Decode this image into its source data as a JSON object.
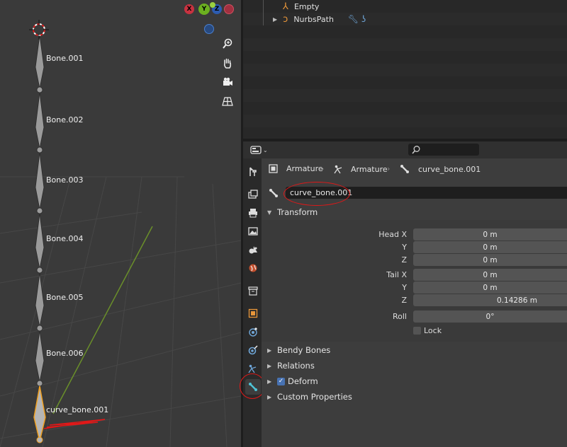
{
  "viewport": {
    "bones": [
      {
        "label": "Bone.001"
      },
      {
        "label": "Bone.002"
      },
      {
        "label": "Bone.003"
      },
      {
        "label": "Bone.004"
      },
      {
        "label": "Bone.005"
      },
      {
        "label": "Bone.006"
      },
      {
        "label": "curve_bone.001"
      }
    ],
    "gizmo": {
      "x": "X",
      "y": "Y",
      "z": "Z"
    },
    "tools": [
      "zoom-icon",
      "hand-icon",
      "camera-icon",
      "grid-icon"
    ]
  },
  "outliner": {
    "items": [
      {
        "label": "Empty",
        "icon": "empty-icon"
      },
      {
        "label": "NurbsPath",
        "icon": "curve-icon"
      }
    ]
  },
  "properties": {
    "search_placeholder": "",
    "breadcrumb": [
      "Armature",
      "Armature",
      "curve_bone.001"
    ],
    "bone_name": "curve_bone.001",
    "transform": {
      "title": "Transform",
      "rows": [
        {
          "label": "Head X",
          "value": "0 m"
        },
        {
          "label": "Y",
          "value": "0 m"
        },
        {
          "label": "Z",
          "value": "0 m"
        },
        {
          "label": "Tail X",
          "value": "0 m"
        },
        {
          "label": "Y",
          "value": "0 m"
        },
        {
          "label": "Z",
          "value": "0.14286 m"
        },
        {
          "label": "Roll",
          "value": "0°"
        }
      ],
      "lock_label": "Lock"
    },
    "panels": {
      "bendy": "Bendy Bones",
      "relations": "Relations",
      "deform": "Deform",
      "custom": "Custom Properties"
    }
  }
}
